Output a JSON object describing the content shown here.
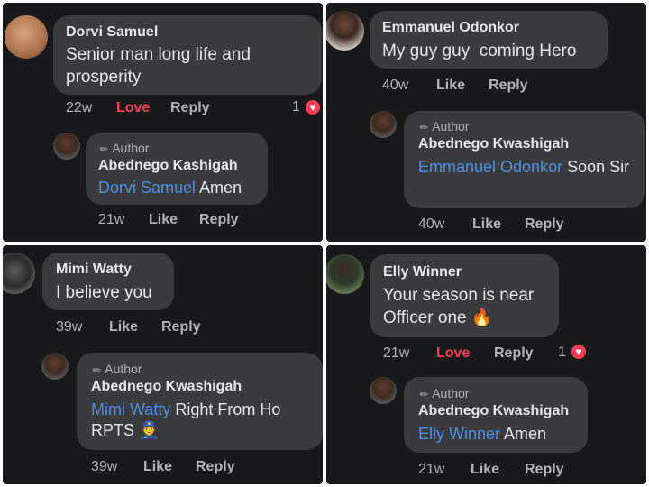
{
  "panels": [
    {
      "comment": {
        "name": "Dorvi Samuel",
        "text": "Senior man long life and prosperity",
        "time": "22w",
        "like": "Love",
        "reply": "Reply",
        "reactions": "1"
      },
      "reply": {
        "author_tag": "Author",
        "name": "Abednego Kashigah",
        "mention": "Dorvi Samuel",
        "text": " Amen",
        "time": "21w",
        "like": "Like",
        "reply": "Reply"
      }
    },
    {
      "comment": {
        "name": "Emmanuel Odonkor",
        "text": "My guy guy  coming Hero",
        "time": "40w",
        "like": "Like",
        "reply": "Reply"
      },
      "reply": {
        "author_tag": "Author",
        "name": "Abednego Kwashigah",
        "mention": "Emmanuel Odonkor",
        "text": " Soon Sir",
        "time": "40w",
        "like": "Like",
        "reply": "Reply"
      }
    },
    {
      "comment": {
        "name": "Mimi Watty",
        "text": "I believe you",
        "time": "39w",
        "like": "Like",
        "reply": "Reply"
      },
      "reply": {
        "author_tag": "Author",
        "name": "Abednego Kwashigah",
        "mention": "Mimi Watty",
        "text": " Right From Ho RPTS 👮",
        "time": "39w",
        "like": "Like",
        "reply": "Reply"
      }
    },
    {
      "comment": {
        "name": "Elly Winner",
        "text": "Your season is near Officer one 🔥",
        "time": "21w",
        "like": "Love",
        "reply": "Reply",
        "reactions": "1"
      },
      "reply": {
        "author_tag": "Author",
        "name": "Abednego Kwashigah",
        "mention": "Elly Winner",
        "text": " Amen",
        "time": "21w",
        "like": "Like",
        "reply": "Reply"
      }
    }
  ],
  "colors": {
    "panel_bg": "#18191a",
    "bubble_bg": "#3a3b3c",
    "mention": "#4c8fe8",
    "love": "#f33e58"
  }
}
